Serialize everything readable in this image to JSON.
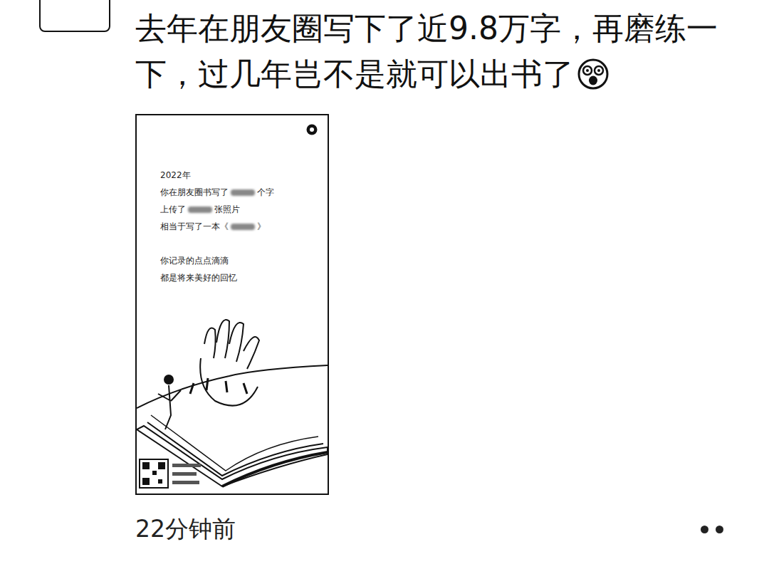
{
  "post": {
    "lines": [
      "去年在朋友圈写下了近9.8万字，再磨练一",
      "下，过几年岂不是就可以出书了"
    ]
  },
  "card": {
    "year": "2022年",
    "stats": [
      {
        "prefix": "你在朋友圈书写了",
        "suffix": "个字"
      },
      {
        "prefix": "上传了",
        "suffix": "张照片"
      },
      {
        "prefix": "相当于写了一本《",
        "suffix": "》"
      }
    ],
    "quote": [
      "你记录的点点滴滴",
      "都是将来美好的回忆"
    ]
  },
  "time": "22分钟前"
}
